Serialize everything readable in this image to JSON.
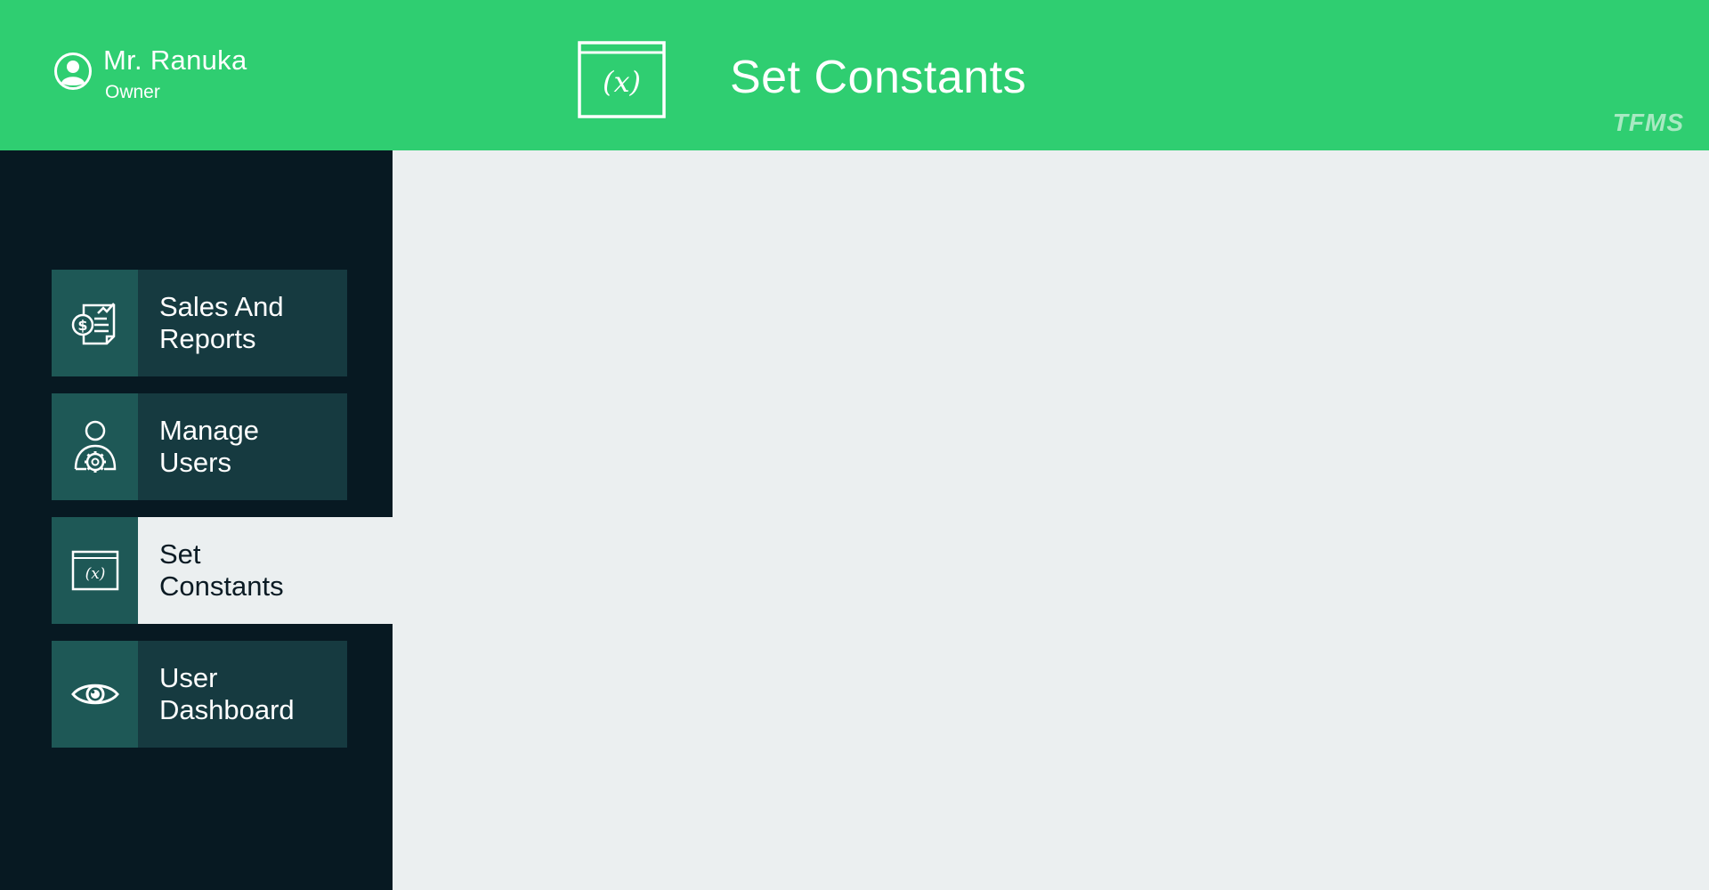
{
  "header": {
    "user_name": "Mr. Ranuka",
    "user_role": "Owner",
    "page_title": "Set Constants",
    "brand": "TFMS",
    "page_icon": "function-window-icon",
    "user_icon": "user-circle-icon"
  },
  "sidebar": {
    "items": [
      {
        "label": "Sales And\nReports",
        "icon": "sales-report-icon",
        "active": false
      },
      {
        "label": "Manage\nUsers",
        "icon": "user-gear-icon",
        "active": false
      },
      {
        "label": "Set\nConstants",
        "icon": "function-window-icon",
        "active": true
      },
      {
        "label": "User\nDashboard",
        "icon": "eye-icon",
        "active": false
      }
    ]
  },
  "colors": {
    "header": "#2fce71",
    "sidebar": "#071922",
    "nav_icon_box": "#1e5856",
    "nav_label_box": "#163a40",
    "content": "#ebeff0",
    "brand": "#a8e9c2"
  }
}
